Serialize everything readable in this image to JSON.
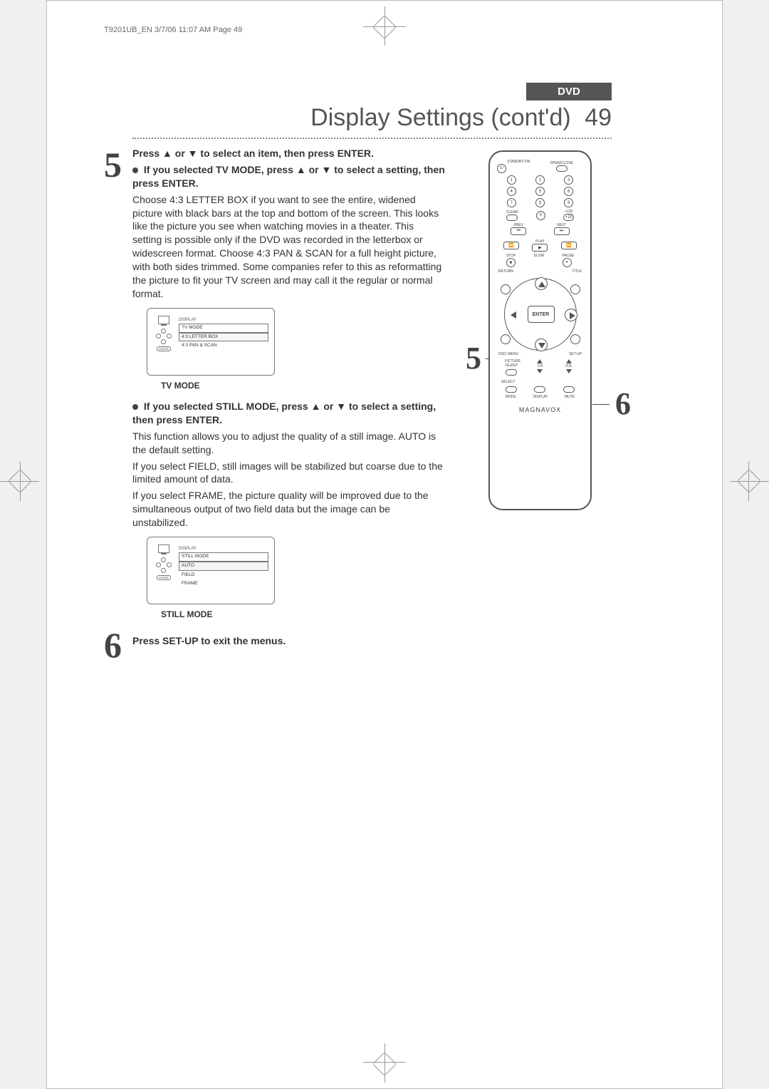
{
  "meta": {
    "header_note": "T9201UB_EN  3/7/06  11:07 AM  Page 49"
  },
  "header": {
    "section": "DVD",
    "title": "Display Settings (cont'd)",
    "page_number": "49"
  },
  "step5": {
    "number": "5",
    "main": "Press ▲ or ▼ to select an item, then press ENTER.",
    "sub1_bold": "If you selected TV MODE, press ▲ or ▼ to select a setting, then press ENTER.",
    "sub1_body": "Choose 4:3 LETTER BOX if you want to see the entire, widened picture with black bars at the top and bottom of the screen.  This looks like the picture you see when watching movies in a theater.  This setting is possible only if the DVD was recorded in the letterbox or widescreen format. Choose 4:3 PAN & SCAN for a full height picture, with both sides trimmed.  Some companies refer to this as reformatting the picture to fit your TV screen and may call it the regular or normal format.",
    "osd1": {
      "header": "DISPLAY",
      "rows": [
        "TV MODE",
        "4:3 LETTER BOX",
        "4:3 PAN & SCAN"
      ],
      "caption": "TV MODE",
      "enter": "ENTER"
    },
    "sub2_bold": "If you selected STILL MODE, press ▲ or ▼ to select a setting, then press ENTER.",
    "sub2_body1": "This function allows you to adjust the quality of a still image.  AUTO is the default setting.",
    "sub2_body2": "If you select FIELD, still images will be stabilized but coarse due to the limited amount of data.",
    "sub2_body3": "If you select FRAME, the picture quality will be improved due to the simultaneous output of two field data but the image can be unstabilized.",
    "osd2": {
      "header": "DISPLAY",
      "rows": [
        "STILL MODE",
        "AUTO",
        "FIELD",
        "FRAME"
      ],
      "caption": "STILL MODE",
      "enter": "ENTER"
    }
  },
  "step6": {
    "number": "6",
    "main": "Press SET-UP to exit the menus."
  },
  "remote": {
    "callout5": "5",
    "callout6": "6",
    "labels": {
      "standby": "STANDBY-ON",
      "openclose": "OPEN/CLOSE",
      "clear": "CLEAR",
      "plus100": "+100",
      "plus10": "+10",
      "prev": "PREV",
      "next": "NEXT",
      "play": "PLAY",
      "stop": "STOP",
      "slow": "SLOW",
      "pause": "PAUSE",
      "return": "RETURN",
      "title": "TITLE",
      "disc": "DISC MENU",
      "setup": "SET-UP",
      "enter": "ENTER",
      "picture": "PICTURE /SLEEP",
      "ch": "CH",
      "vol": "VOL",
      "select": "SELECT",
      "mode": "MODE",
      "display": "DISPLAY",
      "mute": "MUTE"
    },
    "numpad": [
      "1",
      "2",
      "3",
      "4",
      "5",
      "6",
      "7",
      "8",
      "9",
      "0"
    ],
    "brand": "MAGNAVOX"
  }
}
